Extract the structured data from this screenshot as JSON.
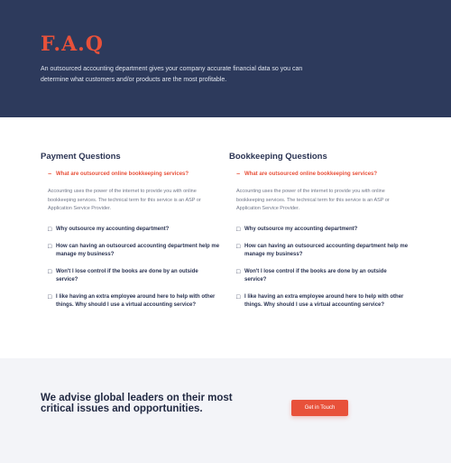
{
  "hero": {
    "title": "F.A.Q",
    "description": "An outsourced accounting department gives your company accurate financial data so you can determine what customers and/or products are the most profitable."
  },
  "columns": [
    {
      "heading": "Payment Questions",
      "items": [
        {
          "question": "What are outsourced online bookkeeping services?",
          "open": true,
          "answer": "Accounting uses the power of the internet to provide you with online bookkeeping services. The technical term for this service is an ASP or Application Service Provider."
        },
        {
          "question": "Why outsource my accounting department?",
          "open": false
        },
        {
          "question": "How can having an outsourced accounting department help me manage my business?",
          "open": false
        },
        {
          "question": "Won't I lose control if the books are done by an outside service?",
          "open": false
        },
        {
          "question": "I like having an extra employee around here to help with other things. Why should I use a virtual accounting service?",
          "open": false
        }
      ]
    },
    {
      "heading": "Bookkeeping Questions",
      "items": [
        {
          "question": "What are outsourced online bookkeeping services?",
          "open": true,
          "answer": "Accounting uses the power of the internet to provide you with online bookkeeping services. The technical term for this service is an ASP or Application Service Provider."
        },
        {
          "question": "Why outsource my accounting department?",
          "open": false
        },
        {
          "question": "How can having an outsourced accounting department help me manage my business?",
          "open": false
        },
        {
          "question": "Won't I lose control if the books are done by an outside service?",
          "open": false
        },
        {
          "question": "I like having an extra employee around here to help with other things. Why should I use a virtual accounting service?",
          "open": false
        }
      ]
    }
  ],
  "icons": {
    "open": "−",
    "closed": "□"
  },
  "cta": {
    "title": "We advise global leaders on their most critical issues and opportunities.",
    "button": "Get in Touch"
  },
  "colors": {
    "hero_bg": "#2d3a5c",
    "accent": "#e8513a",
    "cta_bg": "#f3f4f8"
  }
}
